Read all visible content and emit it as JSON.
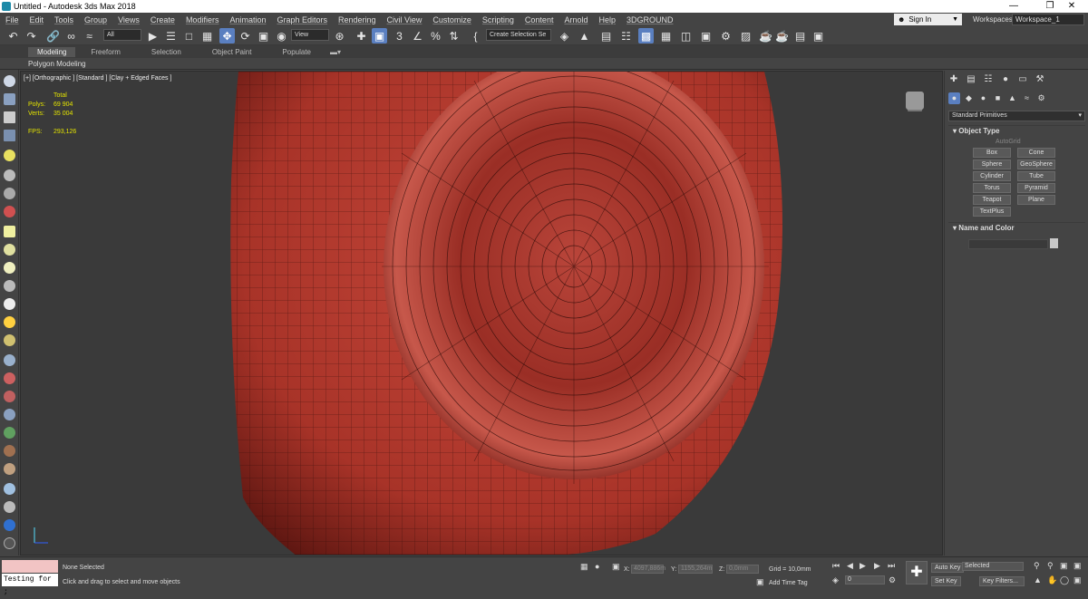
{
  "window": {
    "title": "Untitled - Autodesk 3ds Max 2018"
  },
  "menu": [
    "File",
    "Edit",
    "Tools",
    "Group",
    "Views",
    "Create",
    "Modifiers",
    "Animation",
    "Graph Editors",
    "Rendering",
    "Civil View",
    "Customize",
    "Scripting",
    "Content",
    "Arnold",
    "Help",
    "3DGROUND"
  ],
  "account": {
    "signin": "Sign In",
    "workspaces_label": "Workspaces:",
    "workspace": "Workspace_1"
  },
  "toolbar": {
    "filter": "All",
    "ref_coord": "View",
    "selection_set": "Create Selection Se"
  },
  "ribbon": {
    "tabs": [
      "Modeling",
      "Freeform",
      "Selection",
      "Object Paint",
      "Populate"
    ],
    "active": "Modeling",
    "subtitle": "Polygon Modeling"
  },
  "viewport": {
    "label": "[+] [Orthographic ] [Standard ] [Clay + Edged Faces ]",
    "stats": {
      "total_label": "Total",
      "polys_label": "Polys:",
      "polys": "69 904",
      "verts_label": "Verts:",
      "verts": "35 004",
      "fps_label": "FPS:",
      "fps": "293,126"
    },
    "mesh_color": "#b23a30"
  },
  "command_panel": {
    "dropdown": "Standard Primitives",
    "object_type": "Object Type",
    "autogrid": "AutoGrid",
    "objects": [
      "Box",
      "Cone",
      "Sphere",
      "GeoSphere",
      "Cylinder",
      "Tube",
      "Torus",
      "Pyramid",
      "Teapot",
      "Plane",
      "TextPlus"
    ],
    "name_and_color": "Name and Color"
  },
  "status": {
    "listener_input": "Testing for ;",
    "selection": "None Selected",
    "prompt": "Click and drag to select and move objects",
    "x_label": "X:",
    "x_value": "4097,886m",
    "y_label": "Y:",
    "y_value": "1155,264m",
    "z_label": "Z:",
    "z_value": "0,0mm",
    "grid": "Grid = 10,0mm",
    "add_time_tag": "Add Time Tag",
    "auto_key": "Auto Key",
    "set_key": "Set Key",
    "key_mode": "Selected",
    "key_filters": "Key Filters...",
    "frame": "0"
  },
  "colors": {
    "accent": "#5a7fc0",
    "stats_yellow": "#e3e300",
    "bg": "#444444"
  }
}
